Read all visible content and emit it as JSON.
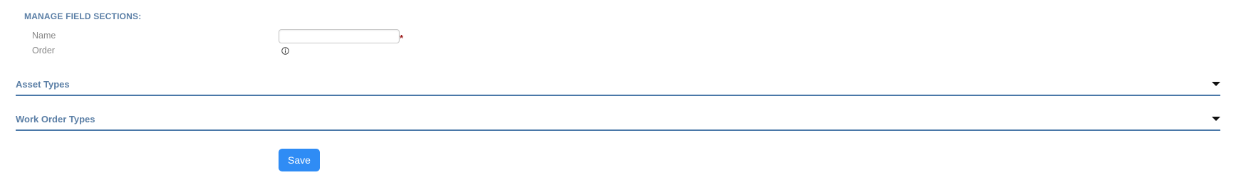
{
  "form": {
    "section_title": "MANAGE FIELD SECTIONS:",
    "name_label": "Name",
    "name_value": "",
    "name_required_marker": "*",
    "order_label": "Order",
    "order_info_icon": "info-circle-icon"
  },
  "accordions": [
    {
      "title": "Asset Types",
      "icon": "caret-down-icon",
      "expanded": false
    },
    {
      "title": "Work Order Types",
      "icon": "caret-down-icon",
      "expanded": false
    }
  ],
  "actions": {
    "save_label": "Save"
  },
  "colors": {
    "heading": "#5b7fa6",
    "divider": "#4a78a8",
    "primary_button": "#2f8cf5",
    "required": "#9b1c1c",
    "label": "#888888"
  }
}
